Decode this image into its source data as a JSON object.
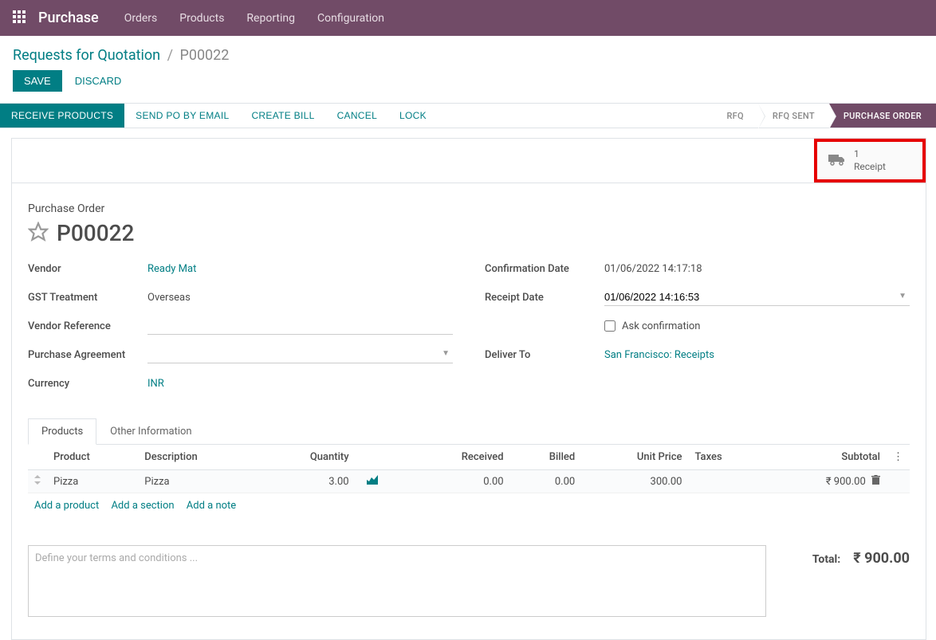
{
  "app_title": "Purchase",
  "nav_menu": [
    "Orders",
    "Products",
    "Reporting",
    "Configuration"
  ],
  "breadcrumb": {
    "parent": "Requests for Quotation",
    "current": "P00022"
  },
  "actions": {
    "save": "SAVE",
    "discard": "DISCARD"
  },
  "status_buttons": {
    "receive": "RECEIVE PRODUCTS",
    "send_po": "SEND PO BY EMAIL",
    "create_bill": "CREATE BILL",
    "cancel": "CANCEL",
    "lock": "LOCK"
  },
  "stages": {
    "rfq": "RFQ",
    "rfq_sent": "RFQ SENT",
    "purchase_order": "PURCHASE ORDER"
  },
  "stat": {
    "count": "1",
    "label": "Receipt"
  },
  "title": {
    "label": "Purchase Order",
    "number": "P00022"
  },
  "fields_left": {
    "vendor_label": "Vendor",
    "vendor_value": "Ready Mat",
    "gst_label": "GST Treatment",
    "gst_value": "Overseas",
    "vendor_ref_label": "Vendor Reference",
    "vendor_ref_value": "",
    "agreement_label": "Purchase Agreement",
    "agreement_value": "",
    "currency_label": "Currency",
    "currency_value": "INR"
  },
  "fields_right": {
    "confirm_date_label": "Confirmation Date",
    "confirm_date_value": "01/06/2022 14:17:18",
    "receipt_date_label": "Receipt Date",
    "receipt_date_value": "01/06/2022 14:16:53",
    "ask_confirm_label": "Ask confirmation",
    "deliver_to_label": "Deliver To",
    "deliver_to_value": "San Francisco: Receipts"
  },
  "tabs": {
    "products": "Products",
    "other": "Other Information"
  },
  "table": {
    "headers": {
      "product": "Product",
      "description": "Description",
      "quantity": "Quantity",
      "received": "Received",
      "billed": "Billed",
      "unit_price": "Unit Price",
      "taxes": "Taxes",
      "subtotal": "Subtotal"
    },
    "rows": [
      {
        "product": "Pizza",
        "description": "Pizza",
        "quantity": "3.00",
        "received": "0.00",
        "billed": "0.00",
        "unit_price": "300.00",
        "taxes": "",
        "subtotal": "₹ 900.00"
      }
    ]
  },
  "add_links": {
    "product": "Add a product",
    "section": "Add a section",
    "note": "Add a note"
  },
  "terms_placeholder": "Define your terms and conditions ...",
  "totals": {
    "label": "Total:",
    "value": "₹ 900.00"
  }
}
